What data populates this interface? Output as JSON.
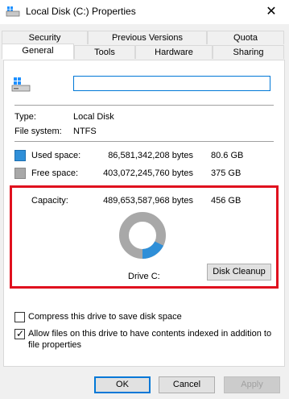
{
  "window": {
    "title": "Local Disk (C:) Properties",
    "close_glyph": "✕"
  },
  "tabs_back": [
    {
      "label": "Security"
    },
    {
      "label": "Previous Versions"
    },
    {
      "label": "Quota"
    }
  ],
  "tabs_front": [
    {
      "label": "General",
      "active": true
    },
    {
      "label": "Tools"
    },
    {
      "label": "Hardware"
    },
    {
      "label": "Sharing"
    }
  ],
  "general": {
    "drive_name_value": "",
    "type_label": "Type:",
    "type_value": "Local Disk",
    "fs_label": "File system:",
    "fs_value": "NTFS",
    "used_label": "Used space:",
    "used_bytes": "86,581,342,208 bytes",
    "used_gb": "80.6 GB",
    "free_label": "Free space:",
    "free_bytes": "403,072,245,760 bytes",
    "free_gb": "375 GB",
    "capacity_label": "Capacity:",
    "capacity_bytes": "489,653,587,968 bytes",
    "capacity_gb": "456 GB",
    "drive_label": "Drive C:",
    "disk_cleanup": "Disk Cleanup",
    "used_fraction": 0.1768
  },
  "options": {
    "compress_label": "Compress this drive to save disk space",
    "compress_checked": false,
    "index_label_line1": "Allow files on this drive to have contents indexed in addition to",
    "index_label_line2": "file properties",
    "index_checked": true
  },
  "buttons": {
    "ok": "OK",
    "cancel": "Cancel",
    "apply": "Apply"
  },
  "colors": {
    "used": "#2f8fd8",
    "free": "#a8a8a8",
    "highlight": "#e0101e",
    "accent": "#0078d7"
  }
}
